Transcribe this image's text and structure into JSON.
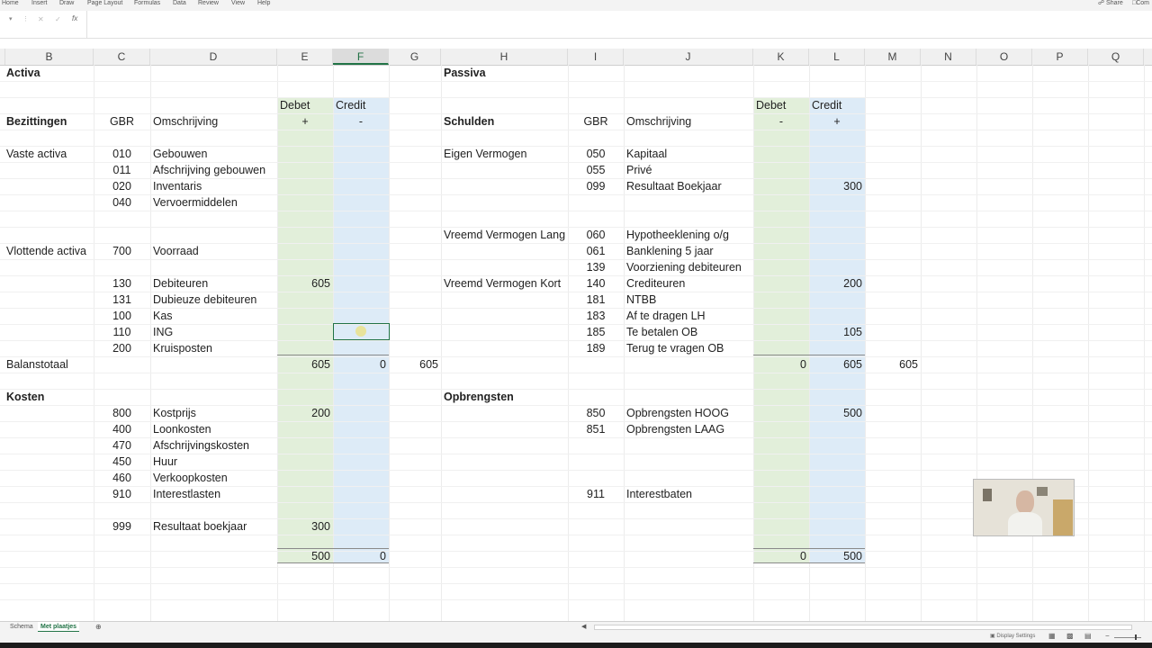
{
  "ribbon": {
    "menus": [
      "Home",
      "Insert",
      "Draw",
      "Page Layout",
      "Formulas",
      "Data",
      "Review",
      "View",
      "Help"
    ],
    "share": "Share",
    "comments": "Com"
  },
  "formula_bar": {
    "fx": "fx"
  },
  "columns": [
    "B",
    "C",
    "D",
    "E",
    "F",
    "G",
    "H",
    "I",
    "J",
    "K",
    "L",
    "M",
    "N",
    "O",
    "P",
    "Q"
  ],
  "selected_column": "F",
  "cells": {
    "activa": "Activa",
    "passiva": "Passiva",
    "debet": "Debet",
    "credit": "Credit",
    "plus": "+",
    "minus": "-",
    "bezittingen": "Bezittingen",
    "schulden": "Schulden",
    "gbr": "GBR",
    "omschrijving": "Omschrijving",
    "vaste_activa": "Vaste activa",
    "eigen_vermogen": "Eigen Vermogen",
    "vreemd_lang": "Vreemd Vermogen Lang",
    "vlottende_activa": "Vlottende activa",
    "vreemd_kort": "Vreemd Vermogen Kort",
    "balanstotaal": "Balanstotaal",
    "kosten": "Kosten",
    "opbrengsten": "Opbrengsten"
  },
  "activa_rows": [
    {
      "code": "010",
      "desc": "Gebouwen",
      "debet": "",
      "credit": ""
    },
    {
      "code": "011",
      "desc": "Afschrijving gebouwen",
      "debet": "",
      "credit": ""
    },
    {
      "code": "020",
      "desc": "Inventaris",
      "debet": "",
      "credit": ""
    },
    {
      "code": "040",
      "desc": "Vervoermiddelen",
      "debet": "",
      "credit": ""
    },
    {
      "code": "700",
      "desc": "Voorraad",
      "debet": "",
      "credit": ""
    },
    {
      "code": "130",
      "desc": "Debiteuren",
      "debet": "605",
      "credit": ""
    },
    {
      "code": "131",
      "desc": "Dubieuze debiteuren",
      "debet": "",
      "credit": ""
    },
    {
      "code": "100",
      "desc": "Kas",
      "debet": "",
      "credit": ""
    },
    {
      "code": "110",
      "desc": "ING",
      "debet": "",
      "credit": ""
    },
    {
      "code": "200",
      "desc": "Kruisposten",
      "debet": "",
      "credit": ""
    }
  ],
  "passiva_rows": [
    {
      "code": "050",
      "desc": "Kapitaal",
      "debet": "",
      "credit": ""
    },
    {
      "code": "055",
      "desc": "Privé",
      "debet": "",
      "credit": ""
    },
    {
      "code": "099",
      "desc": "Resultaat Boekjaar",
      "debet": "",
      "credit": "300"
    },
    {
      "code": "060",
      "desc": "Hypotheeklening o/g",
      "debet": "",
      "credit": ""
    },
    {
      "code": "061",
      "desc": "Banklening 5 jaar",
      "debet": "",
      "credit": ""
    },
    {
      "code": "139",
      "desc": "Voorziening debiteuren",
      "debet": "",
      "credit": ""
    },
    {
      "code": "140",
      "desc": "Crediteuren",
      "debet": "",
      "credit": "200"
    },
    {
      "code": "181",
      "desc": "NTBB",
      "debet": "",
      "credit": ""
    },
    {
      "code": "183",
      "desc": "Af te dragen LH",
      "debet": "",
      "credit": ""
    },
    {
      "code": "185",
      "desc": "Te betalen OB",
      "debet": "",
      "credit": "105"
    },
    {
      "code": "189",
      "desc": "Terug te vragen OB",
      "debet": "",
      "credit": ""
    }
  ],
  "balans_totals": {
    "activa_debet": "605",
    "activa_credit": "0",
    "activa_sum": "605",
    "passiva_debet": "0",
    "passiva_credit": "605",
    "passiva_sum": "605"
  },
  "kosten_rows": [
    {
      "code": "800",
      "desc": "Kostprijs",
      "debet": "200"
    },
    {
      "code": "400",
      "desc": "Loonkosten",
      "debet": ""
    },
    {
      "code": "470",
      "desc": "Afschrijvingskosten",
      "debet": ""
    },
    {
      "code": "450",
      "desc": "Huur",
      "debet": ""
    },
    {
      "code": "460",
      "desc": "Verkoopkosten",
      "debet": ""
    },
    {
      "code": "910",
      "desc": "Interestlasten",
      "debet": ""
    },
    {
      "code": "999",
      "desc": "Resultaat boekjaar",
      "debet": "300"
    }
  ],
  "opbrengsten_rows": [
    {
      "code": "850",
      "desc": "Opbrengsten HOOG",
      "credit": "500"
    },
    {
      "code": "851",
      "desc": "Opbrengsten LAAG",
      "credit": ""
    },
    {
      "code": "911",
      "desc": "Interestbaten",
      "credit": ""
    }
  ],
  "resultaat_totals": {
    "kosten_debet": "500",
    "kosten_credit": "0",
    "opbrengsten_debet": "0",
    "opbrengsten_credit": "500"
  },
  "sheet_tabs": {
    "tab1": "Schema",
    "tab2": "Met plaatjes",
    "active": "Met plaatjes"
  },
  "status": {
    "display_settings": "Display Settings"
  },
  "colors": {
    "debet_fill": "#e2efda",
    "credit_fill": "#ddebf7",
    "accent": "#217346"
  }
}
